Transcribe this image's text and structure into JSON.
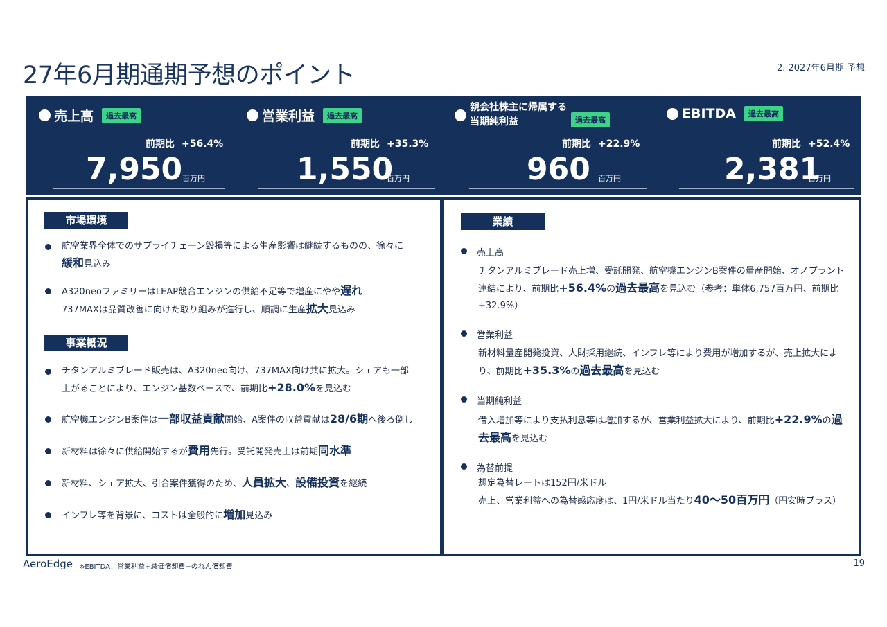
{
  "header": {
    "title": "27年6月期通期予想のポイント",
    "section": "2. 2027年6月期 予想"
  },
  "kpis": [
    {
      "label": "売上高",
      "badge": "過去最高",
      "yoy_label": "前期比",
      "yoy_value": "+56.4%",
      "value": "7,950",
      "unit": "百万円"
    },
    {
      "label": "営業利益",
      "badge": "過去最高",
      "yoy_label": "前期比",
      "yoy_value": "+35.3%",
      "value": "1,550",
      "unit": "百万円"
    },
    {
      "label_line1": "親会社株主に帰属する",
      "label_line2": "当期純利益",
      "badge": "過去最高",
      "yoy_label": "前期比",
      "yoy_value": "+22.9%",
      "value": "960",
      "unit": "百万円"
    },
    {
      "label": "EBITDA",
      "badge": "過去最高",
      "yoy_label": "前期比",
      "yoy_value": "+52.4%",
      "value": "2,381",
      "unit": "百万円"
    }
  ],
  "left": {
    "market_title": "市場環境",
    "market": [
      {
        "p1": "航空業界全体でのサプライチェーン毀損等による生産影響は継続するものの、徐々に",
        "h1": "緩和",
        "p2": "見込み"
      },
      {
        "p1": "A320neoファミリーはLEAP競合エンジンの供給不足等で増産にやや",
        "h1": "遅れ",
        "p2": "737MAXは品質改善に向けた取り組みが進行し、順調に生産",
        "h2": "拡大",
        "p3": "見込み"
      }
    ],
    "business_title": "事業概況",
    "business": [
      {
        "p1": "チタンアルミブレード販売は、A320neo向け、737MAX向け共に拡大。シェアも一部上がることにより、エンジン基数ベースで、前期比",
        "h1": "+28.0%",
        "p2": "を見込む"
      },
      {
        "p1": "航空機エンジンB案件は",
        "h1": "一部収益貢献",
        "p2": "開始、A案件の収益貢献は",
        "h2": "28/6期",
        "p3": "へ後ろ倒し"
      },
      {
        "p1": "新材料は徐々に供給開始するが",
        "h1": "費用",
        "p2": "先行。受託開発売上は前期",
        "h2": "同水準"
      },
      {
        "p1": "新材料、シェア拡大、引合案件獲得のため、",
        "h1": "人員拡大",
        "p2": "、",
        "h2": "設備投資",
        "p3": "を継続"
      },
      {
        "p1": "インフレ等を背景に、コストは全般的に",
        "h1": "増加",
        "p2": "見込み"
      }
    ]
  },
  "right": {
    "title": "業績",
    "sections": [
      {
        "head": "売上高",
        "p1": "チタンアルミブレード売上増、受託開発、航空機エンジンB案件の量産開始、オノプラント連結により、前期比",
        "h1": "+56.4%",
        "p2": "の",
        "h2": "過去最高",
        "p3": "を見込む（参考：単体6,757百万円、前期比+32.9%）"
      },
      {
        "head": "営業利益",
        "p1": "新材料量産開発投資、人財採用継続、インフレ等により費用が増加するが、売上拡大により、前期比",
        "h1": "+35.3%",
        "p2": "の",
        "h2": "過去最高",
        "p3": "を見込む"
      },
      {
        "head": "当期純利益",
        "p1": "借入増加等により支払利息等は増加するが、営業利益拡大により、前期比",
        "h1": "+22.9%",
        "p2": "の",
        "h2": "過去最高",
        "p3": "を見込む"
      },
      {
        "head": "為替前提",
        "line1": "想定為替レートは152円/米ドル",
        "p1": "売上、営業利益への為替感応度は、1円/米ドル当たり",
        "h1": "40～50百万円",
        "p2": "（円安時プラス）"
      }
    ]
  },
  "footer": {
    "brand": "AeroEdge",
    "note": "※EBITDA：営業利益+減価償却費+のれん償却費",
    "page": "19"
  }
}
